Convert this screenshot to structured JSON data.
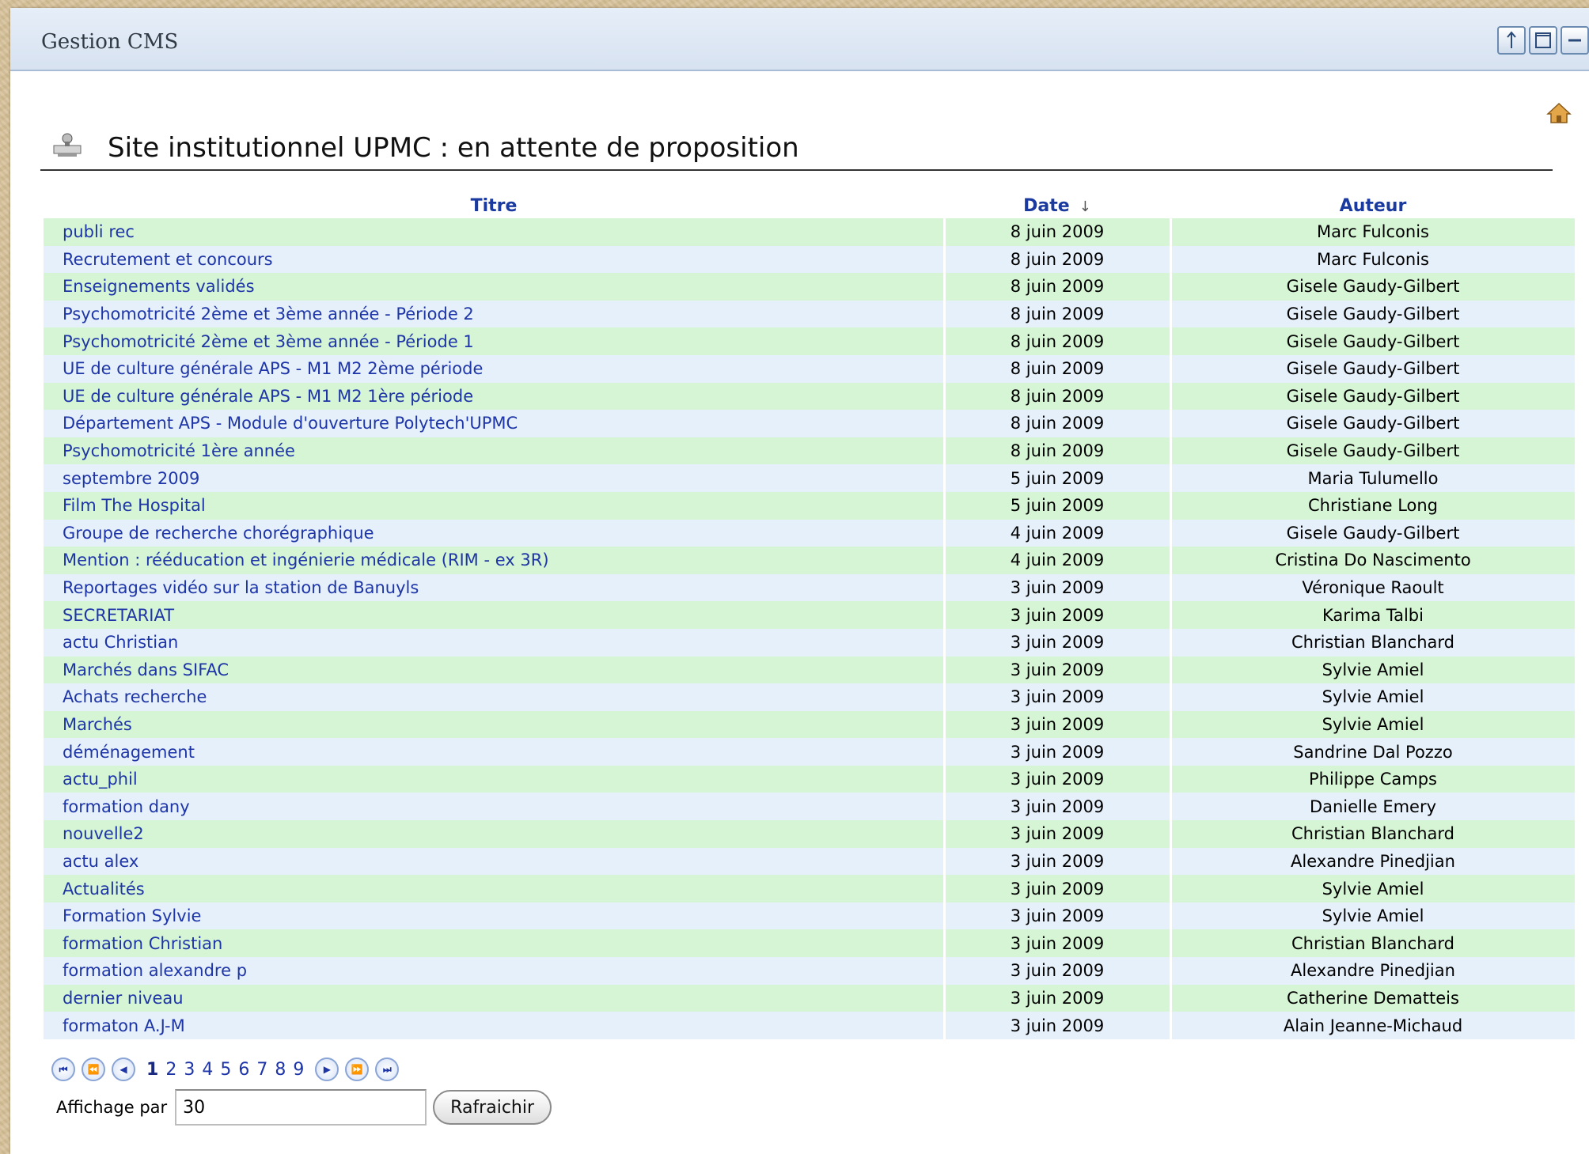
{
  "header": {
    "title": "Gestion CMS"
  },
  "window_buttons": [
    "move-up-icon",
    "maximize-icon",
    "minimize-icon"
  ],
  "page": {
    "heading": "Site institutionnel UPMC : en attente de proposition"
  },
  "table": {
    "columns": {
      "title": "Titre",
      "date": "Date",
      "author": "Auteur"
    },
    "rows": [
      {
        "title": "publi rec",
        "date": "8 juin 2009",
        "author": "Marc Fulconis"
      },
      {
        "title": "Recrutement et concours",
        "date": "8 juin 2009",
        "author": "Marc Fulconis"
      },
      {
        "title": "Enseignements validés",
        "date": "8 juin 2009",
        "author": "Gisele Gaudy-Gilbert"
      },
      {
        "title": "Psychomotricité 2ème et 3ème année - Période 2",
        "date": "8 juin 2009",
        "author": "Gisele Gaudy-Gilbert"
      },
      {
        "title": "Psychomotricité 2ème et 3ème année - Période 1",
        "date": "8 juin 2009",
        "author": "Gisele Gaudy-Gilbert"
      },
      {
        "title": "UE de culture générale APS - M1 M2 2ème période",
        "date": "8 juin 2009",
        "author": "Gisele Gaudy-Gilbert"
      },
      {
        "title": "UE de culture générale APS - M1 M2 1ère période",
        "date": "8 juin 2009",
        "author": "Gisele Gaudy-Gilbert"
      },
      {
        "title": "Département APS - Module d'ouverture Polytech'UPMC",
        "date": "8 juin 2009",
        "author": "Gisele Gaudy-Gilbert"
      },
      {
        "title": "Psychomotricité 1ère année",
        "date": "8 juin 2009",
        "author": "Gisele Gaudy-Gilbert"
      },
      {
        "title": "septembre 2009",
        "date": "5 juin 2009",
        "author": "Maria Tulumello"
      },
      {
        "title": "Film The Hospital",
        "date": "5 juin 2009",
        "author": "Christiane Long"
      },
      {
        "title": "Groupe de recherche chorégraphique",
        "date": "4 juin 2009",
        "author": "Gisele Gaudy-Gilbert"
      },
      {
        "title": "Mention : rééducation et ingénierie médicale (RIM - ex 3R)",
        "date": "4 juin 2009",
        "author": "Cristina Do Nascimento"
      },
      {
        "title": "Reportages vidéo sur la station de Banuyls",
        "date": "3 juin 2009",
        "author": "Véronique Raoult"
      },
      {
        "title": "SECRETARIAT",
        "date": "3 juin 2009",
        "author": "Karima Talbi"
      },
      {
        "title": "actu Christian",
        "date": "3 juin 2009",
        "author": "Christian Blanchard"
      },
      {
        "title": "Marchés dans SIFAC",
        "date": "3 juin 2009",
        "author": "Sylvie Amiel"
      },
      {
        "title": "Achats recherche",
        "date": "3 juin 2009",
        "author": "Sylvie Amiel"
      },
      {
        "title": "Marchés",
        "date": "3 juin 2009",
        "author": "Sylvie Amiel"
      },
      {
        "title": "déménagement",
        "date": "3 juin 2009",
        "author": "Sandrine Dal Pozzo"
      },
      {
        "title": "actu_phil",
        "date": "3 juin 2009",
        "author": "Philippe Camps"
      },
      {
        "title": "formation dany",
        "date": "3 juin 2009",
        "author": "Danielle Emery"
      },
      {
        "title": "nouvelle2",
        "date": "3 juin 2009",
        "author": "Christian Blanchard"
      },
      {
        "title": "actu alex",
        "date": "3 juin 2009",
        "author": "Alexandre Pinedjian"
      },
      {
        "title": "Actualités",
        "date": "3 juin 2009",
        "author": "Sylvie Amiel"
      },
      {
        "title": "Formation Sylvie",
        "date": "3 juin 2009",
        "author": "Sylvie Amiel"
      },
      {
        "title": "formation Christian",
        "date": "3 juin 2009",
        "author": "Christian Blanchard"
      },
      {
        "title": "formation alexandre p",
        "date": "3 juin 2009",
        "author": "Alexandre Pinedjian"
      },
      {
        "title": "dernier niveau",
        "date": "3 juin 2009",
        "author": "Catherine Dematteis"
      },
      {
        "title": "formaton A.J-M",
        "date": "3 juin 2009",
        "author": "Alain Jeanne-Michaud"
      }
    ]
  },
  "pagination": {
    "pages": [
      "1",
      "2",
      "3",
      "4",
      "5",
      "6",
      "7",
      "8",
      "9"
    ],
    "current_page": "1"
  },
  "per_page": {
    "label": "Affichage par",
    "value": "30",
    "refresh_label": "Rafraichir"
  },
  "colors": {
    "odd_row": "#d6f5d4",
    "even_row": "#e5f0fa",
    "link": "#1e35a8"
  }
}
